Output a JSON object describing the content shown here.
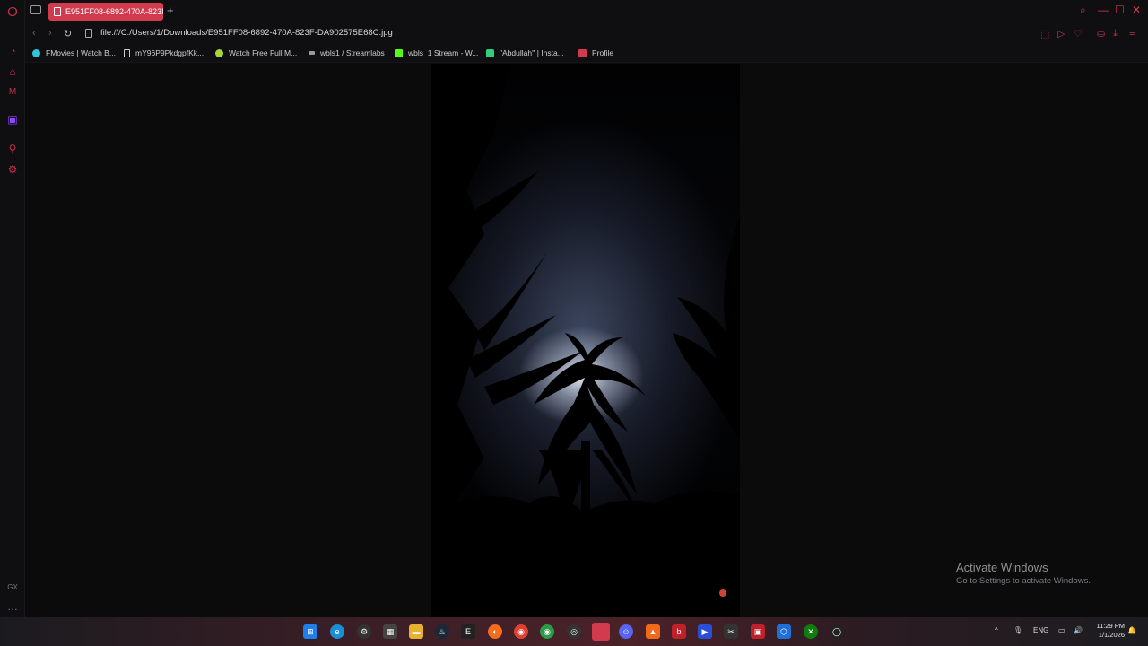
{
  "browser": {
    "tab": {
      "title": "E951FF08-6892-470A-823F-DA902575E68C.jpg"
    },
    "address_bar": {
      "url": "file:///C:/Users/1/Downloads/E951FF08-6892-470A-823F-DA902575E68C.jpg"
    },
    "bookmarks": [
      {
        "label": "FMovies | Watch B...",
        "color": "#2ec5d8"
      },
      {
        "label": "mY96P9PkdgpfKk...",
        "color": "#cccccc"
      },
      {
        "label": "Watch Free Full M...",
        "color": "#a6d63b"
      },
      {
        "label": "wbls1 / Streamlabs",
        "color": "#999999"
      },
      {
        "label": "wbls_1 Stream - W...",
        "color": "#53fc18"
      },
      {
        "label": "\"Abdullah'' | Insta...",
        "color": "#2fd07a"
      },
      {
        "label": "Profile",
        "color": "#d23a4e"
      }
    ],
    "accent_color": "#d23a4e"
  },
  "watermark": {
    "title": "Activate Windows",
    "subtitle": "Go to Settings to activate Windows."
  },
  "taskbar": {
    "language": "ENG",
    "time": "11:29 PM",
    "date": "1/1/2026"
  }
}
